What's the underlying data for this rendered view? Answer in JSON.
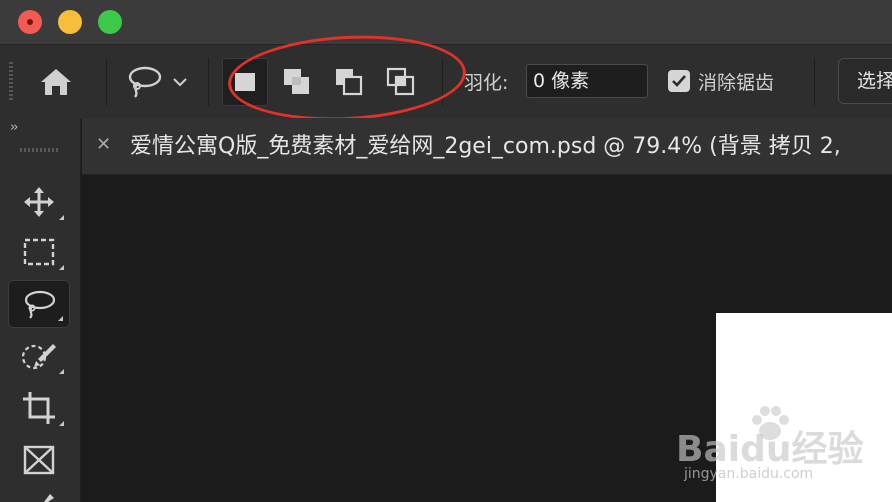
{
  "window": {
    "controls": [
      "close",
      "minimize",
      "zoom"
    ],
    "colors": {
      "close": "#f25a52",
      "minimize": "#f6be3b",
      "zoom": "#3fc94a"
    }
  },
  "options_bar": {
    "home_icon": "home-icon",
    "current_tool_icon": "lasso-icon",
    "selection_modes": [
      "new-selection",
      "add-to-selection",
      "subtract-from-selection",
      "intersect-with-selection"
    ],
    "feather_label": "羽化:",
    "feather_value": "0 像素",
    "antialias_label": "消除锯齿",
    "antialias_checked": true,
    "select_button": "选择"
  },
  "toolbar": {
    "collapse_label": "››",
    "tools": [
      "move-tool",
      "rectangular-marquee-tool",
      "lasso-tool",
      "quick-selection-tool",
      "crop-tool",
      "frame-tool",
      "eyedropper-tool"
    ],
    "active_tool": "lasso-tool"
  },
  "document": {
    "tab_title": "爱情公寓Q版_免费素材_爱给网_2gei_com.psd @ 79.4% (背景 拷贝 2,"
  },
  "watermark": {
    "brand": "Baidu经验",
    "url": "jingyan.baidu.com"
  },
  "annotation_color": "#e0312a"
}
